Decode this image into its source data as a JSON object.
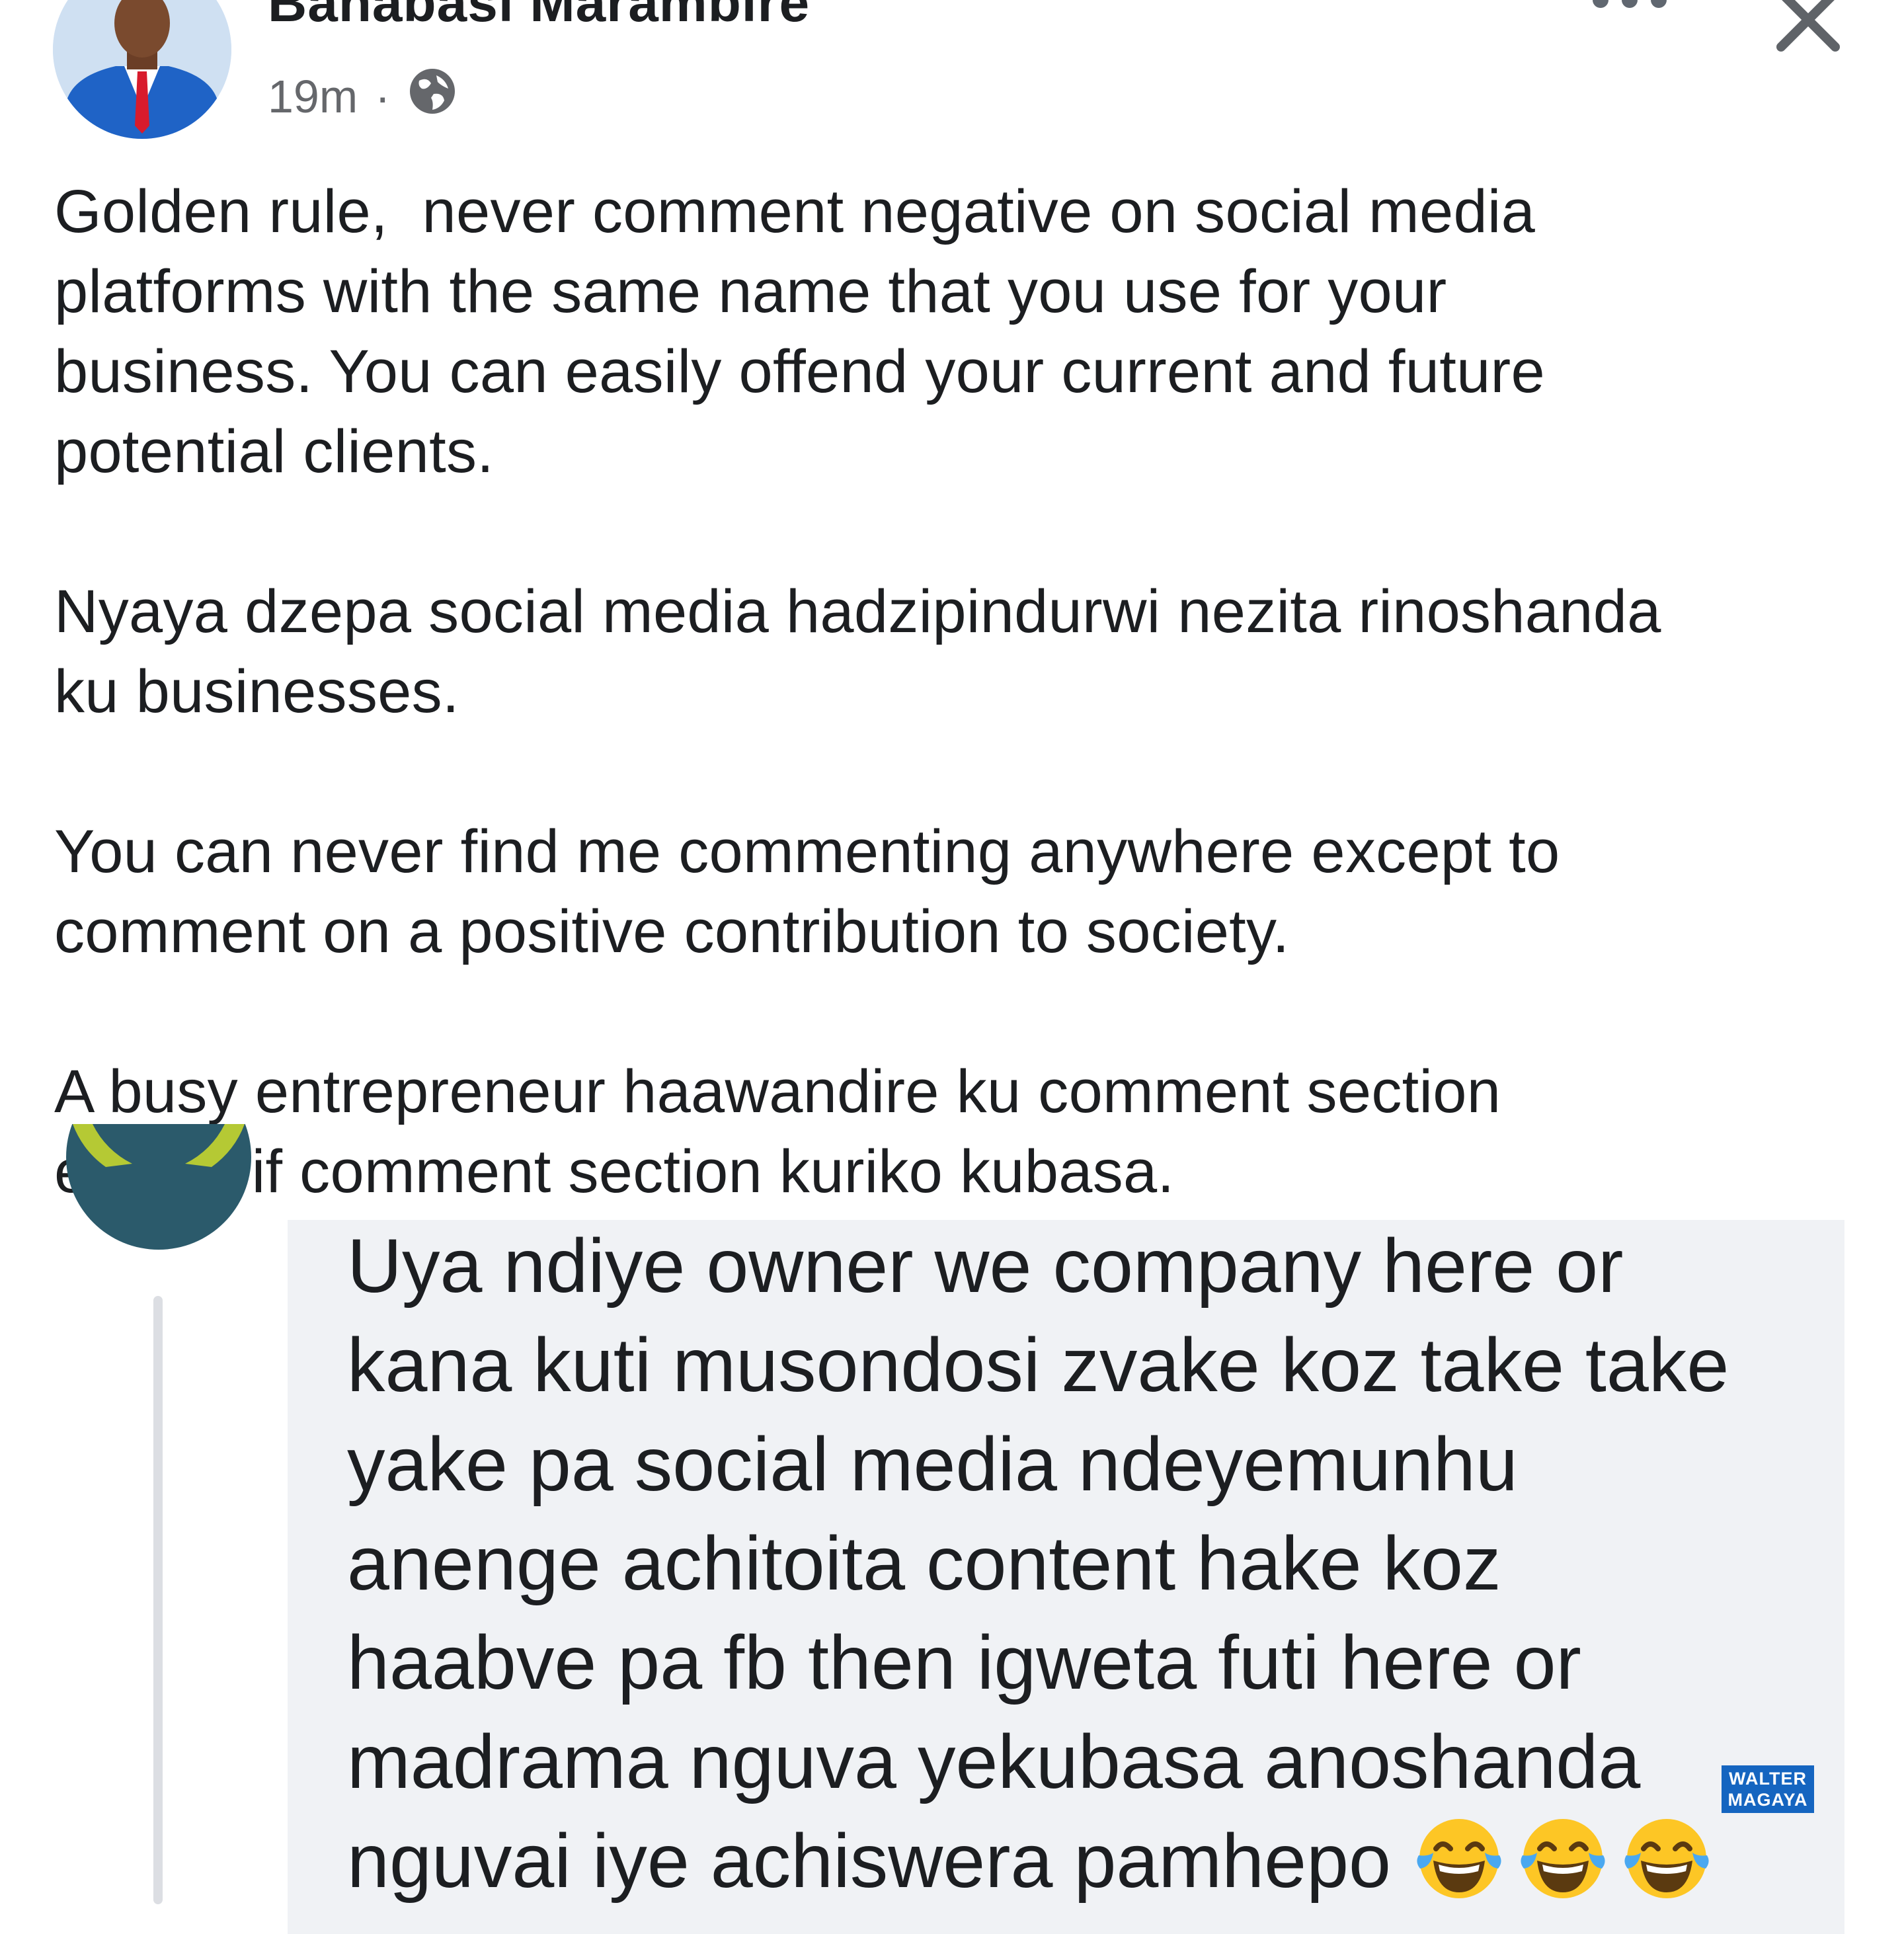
{
  "post": {
    "author": "Banabasi Marambire",
    "time": "19m",
    "separator": "·",
    "audience_icon": "globe-icon",
    "more_icon": "more-options-icon",
    "close_icon": "close-icon",
    "body": "Golden rule,  never comment negative on social media\nplatforms with the same name that you use for your\nbusiness. You can easily offend your current and future\npotential clients.\n\nNyaya dzepa social media hadzipindurwi nezita rinoshanda\nku businesses.\n\nYou can never find me commenting anywhere except to\ncomment on a positive contribution to society.\n\nA busy entrepreneur haawandire ku comment section\nexcept if comment section kuriko kubasa."
  },
  "comment": {
    "text": "Uya ndiye owner we company here or\nkana kuti musondosi zvake koz take take\nyake pa social media ndeyemunhu\nanenge achitoita content hake koz\nhaabve pa fb then igweta futi here or\nmadrama nguva yekubasa anoshanda\nnguvai iye achiswera pamhepo",
    "emoji": [
      "face-with-tears-of-joy",
      "face-with-tears-of-joy",
      "face-with-tears-of-joy"
    ]
  },
  "watermark": {
    "line1": "WALTER",
    "line2": "MAGAYA",
    "color": "#1565c0"
  }
}
